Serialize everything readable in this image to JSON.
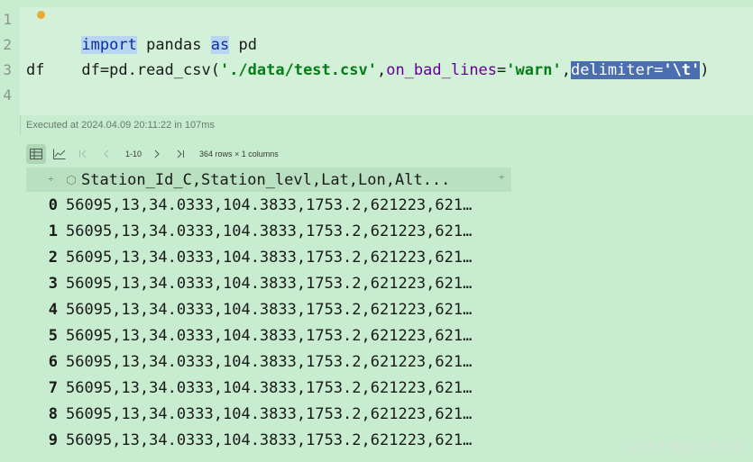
{
  "editor": {
    "line_numbers": [
      "1",
      "2",
      "3",
      "4"
    ],
    "line1": {
      "kw_import": "import",
      "mod": " pandas ",
      "kw_as": "as",
      "alias": " pd"
    },
    "line2": {
      "prefix": "df=pd.read_csv(",
      "path": "'./data/test.csv'",
      "comma1": ",",
      "param1": "on_bad_lines",
      "eq1": "=",
      "val1": "'warn'",
      "comma2": ",",
      "param2": "delimiter",
      "eq2": "=",
      "val2": "'\\t'",
      "close": ")"
    },
    "line3": "df",
    "exec_info": "Executed at 2024.04.09 20:11:22 in 107ms"
  },
  "output": {
    "toolbar": {
      "range": "1-10",
      "summary": "364 rows × 1 columns"
    },
    "table": {
      "header_index_sort": "÷",
      "column_header": "Station_Id_C,Station_levl,Lat,Lon,Alt...",
      "column_sort": "÷",
      "rows": [
        {
          "idx": "0",
          "value": "56095,13,34.0333,104.3833,1753.2,621223,621…"
        },
        {
          "idx": "1",
          "value": "56095,13,34.0333,104.3833,1753.2,621223,621…"
        },
        {
          "idx": "2",
          "value": "56095,13,34.0333,104.3833,1753.2,621223,621…"
        },
        {
          "idx": "3",
          "value": "56095,13,34.0333,104.3833,1753.2,621223,621…"
        },
        {
          "idx": "4",
          "value": "56095,13,34.0333,104.3833,1753.2,621223,621…"
        },
        {
          "idx": "5",
          "value": "56095,13,34.0333,104.3833,1753.2,621223,621…"
        },
        {
          "idx": "6",
          "value": "56095,13,34.0333,104.3833,1753.2,621223,621…"
        },
        {
          "idx": "7",
          "value": "56095,13,34.0333,104.3833,1753.2,621223,621…"
        },
        {
          "idx": "8",
          "value": "56095,13,34.0333,104.3833,1753.2,621223,621…"
        },
        {
          "idx": "9",
          "value": "56095,13,34.0333,104.3833,1753.2,621223,621…"
        }
      ]
    }
  },
  "watermark": "@稀土掘金技术社区",
  "colors": {
    "background": "#c7eccf",
    "editor_bg": "#d2f1d8",
    "keyword": "#0b2f9c",
    "string": "#067d17",
    "param": "#660099",
    "selection": "#4b6eaf"
  },
  "icons": [
    "table-view-icon",
    "chart-view-icon",
    "first-page-icon",
    "prev-page-icon",
    "next-page-icon",
    "last-page-icon",
    "key-column-icon"
  ]
}
